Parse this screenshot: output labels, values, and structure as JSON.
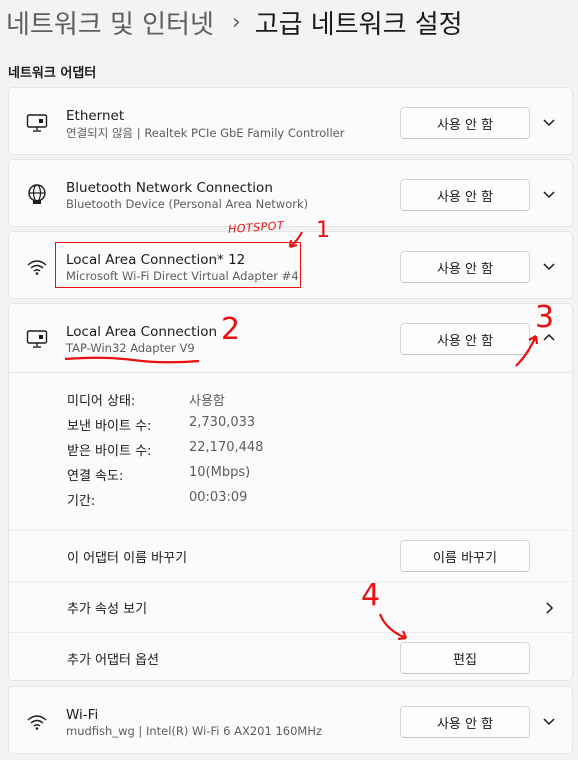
{
  "breadcrumb": {
    "parent": "네트워크 및 인터넷",
    "separator": "›",
    "current": "고급 네트워크 설정"
  },
  "section_title": "네트워크 어댑터",
  "adapters": [
    {
      "name": "Ethernet",
      "description": "연결되지 않음 | Realtek PCIe GbE Family Controller",
      "button": "사용 안 함",
      "icon": "ethernet-icon"
    },
    {
      "name": "Bluetooth Network Connection",
      "description": "Bluetooth Device (Personal Area Network)",
      "button": "사용 안 함",
      "icon": "globe-icon"
    },
    {
      "name": "Local Area Connection* 12",
      "description": "Microsoft Wi-Fi Direct Virtual Adapter #4",
      "button": "사용 안 함",
      "icon": "wifi-icon"
    },
    {
      "name": "Local Area Connection",
      "description": "TAP-Win32 Adapter V9",
      "button": "사용 안 함",
      "icon": "ethernet-icon",
      "expanded": true,
      "details": [
        {
          "label": "미디어 상태:",
          "value": "사용함"
        },
        {
          "label": "보낸 바이트 수:",
          "value": "2,730,033"
        },
        {
          "label": "받은 바이트 수:",
          "value": "22,170,448"
        },
        {
          "label": "연결 속도:",
          "value": "10(Mbps)"
        },
        {
          "label": "기간:",
          "value": "00:03:09"
        }
      ],
      "rename": {
        "label": "이 어댑터 이름 바꾸기",
        "button": "이름 바꾸기"
      },
      "properties": {
        "label": "추가 속성 보기"
      },
      "options": {
        "label": "추가 어댑터 옵션",
        "button": "편집"
      }
    },
    {
      "name": "Wi-Fi",
      "description": "mudfish_wg | Intel(R) Wi-Fi 6 AX201 160MHz",
      "button": "사용 안 함",
      "icon": "wifi-icon"
    }
  ],
  "annotations": {
    "hotspot": "HOTSPOT",
    "n1": "1",
    "n2": "2",
    "n3": "3",
    "n4": "4",
    "color": "#e81010"
  }
}
